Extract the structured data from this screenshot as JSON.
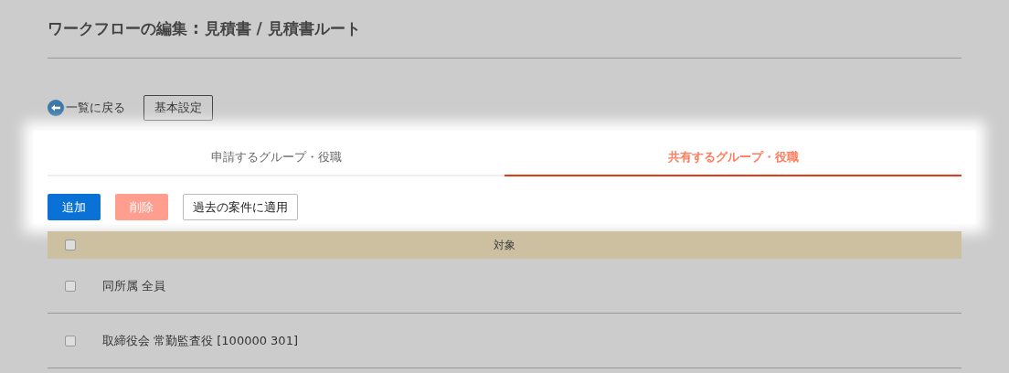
{
  "title": "ワークフローの編集 : 見積書 / 見積書ルート",
  "back_link": "一覧に戻る",
  "settings_button": "基本設定",
  "tabs": [
    {
      "label": "申請するグループ・役職",
      "selected": false
    },
    {
      "label": "共有するグループ・役職",
      "selected": true
    }
  ],
  "actions": [
    {
      "label": "追加",
      "kind": "primary",
      "disabled": false
    },
    {
      "label": "削除",
      "kind": "danger",
      "disabled": true
    },
    {
      "label": "過去の案件に適用",
      "kind": "plain",
      "disabled": false
    }
  ],
  "table": {
    "select_all_checked": false,
    "columns": [
      "対象"
    ],
    "rows": [
      {
        "target": "同所属 全員",
        "checked": false
      },
      {
        "target": "取締役会 常勤監査役 [100000 301]",
        "checked": false
      }
    ]
  }
}
